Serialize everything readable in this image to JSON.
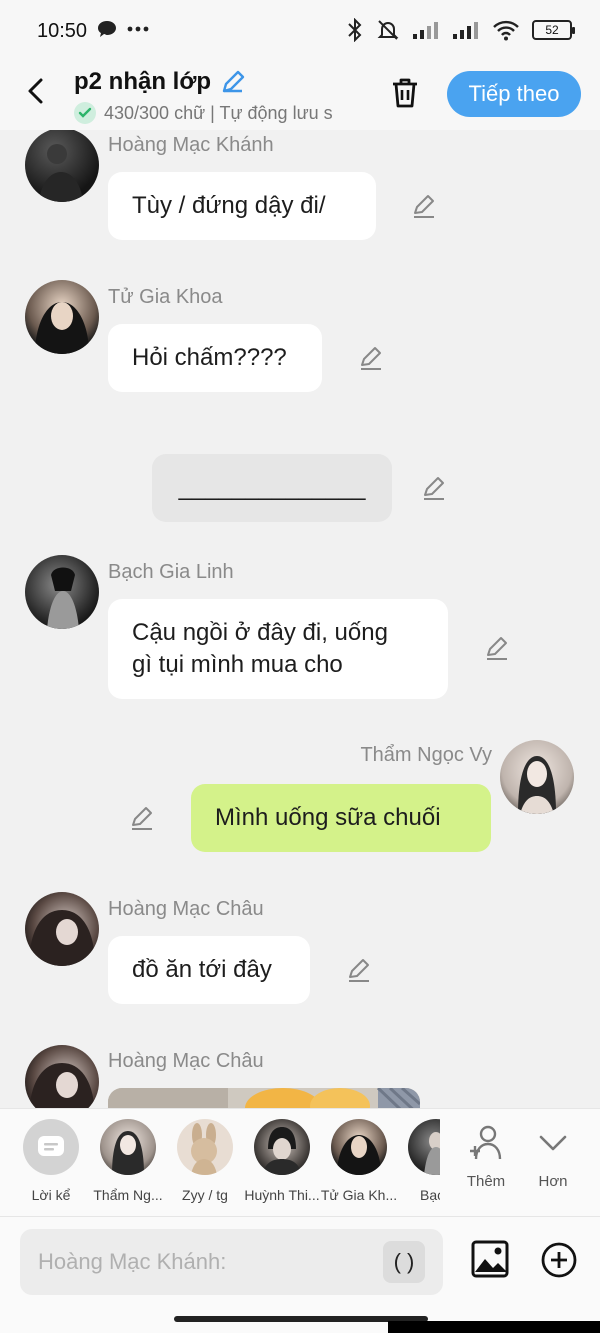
{
  "status_bar": {
    "time": "10:50",
    "battery": "52"
  },
  "header": {
    "title": "p2 nhận lớp",
    "subtitle": "430/300 chữ | Tự động lưu s",
    "next_label": "Tiếp theo"
  },
  "messages": [
    {
      "sender": "Hoàng Mạc Khánh",
      "text": "Tùy / đứng dậy đi/"
    },
    {
      "sender": "Tử Gia Khoa",
      "text": "Hỏi chấm????"
    },
    {
      "text": "______________"
    },
    {
      "sender": "Bạch Gia Linh",
      "text_line1": "Cậu ngồi ở đây đi, uống",
      "text_line2": "gì tụi mình mua cho"
    },
    {
      "sender": "Thẩm Ngọc Vy",
      "text": "Mình uống sữa chuối"
    },
    {
      "sender": "Hoàng Mạc Châu",
      "text": "đồ ăn tới đây"
    },
    {
      "sender": "Hoàng Mạc Châu"
    }
  ],
  "characters": [
    {
      "name": "Lời kể"
    },
    {
      "name": "Thẩm Ng..."
    },
    {
      "name": "Zyy / tg"
    },
    {
      "name": "Huỳnh Thi..."
    },
    {
      "name": "Tử Gia Kh..."
    },
    {
      "name": "Bạch"
    }
  ],
  "side_buttons": {
    "add_label": "Thêm",
    "more_label": "Hơn"
  },
  "input": {
    "placeholder": "Hoàng Mạc Khánh:",
    "paren_label": "( )"
  },
  "colors": {
    "accent": "#4aa3f0",
    "mine_bubble": "#d4f28a",
    "background": "#f1f1f1"
  }
}
